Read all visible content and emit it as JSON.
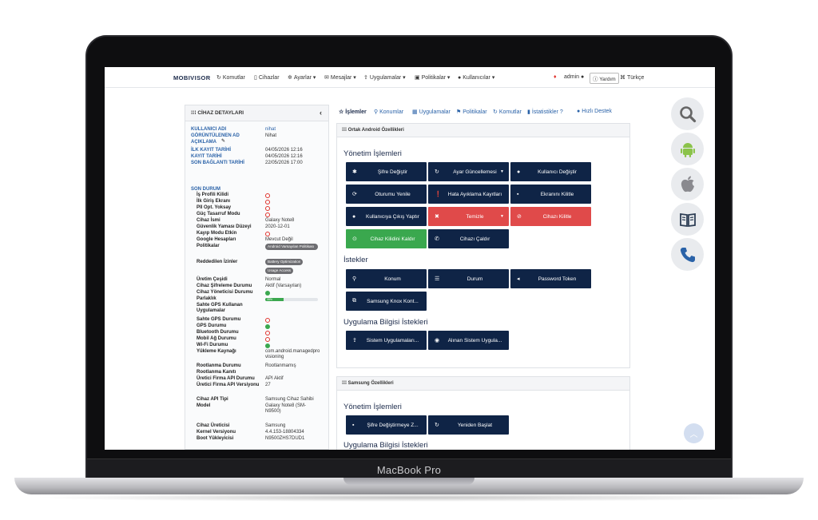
{
  "device_label": "MacBook Pro",
  "navbar": {
    "brand": "MOBIVISOR",
    "items": [
      {
        "icon": "command-icon",
        "label": "Komutlar"
      },
      {
        "icon": "device-icon",
        "label": "Cihazlar"
      },
      {
        "icon": "gear-icon",
        "label": "Ayarlar"
      },
      {
        "icon": "envelope-icon",
        "label": "Mesajlar"
      },
      {
        "icon": "apps-icon",
        "label": "Uygulamalar"
      },
      {
        "icon": "policy-icon",
        "label": "Politikalar"
      },
      {
        "icon": "user-icon",
        "label": "Kullanıcılar"
      }
    ],
    "user": "admin",
    "help": "Yardım",
    "language": "Türkçe"
  },
  "device_panel": {
    "title": "CİHAZ DETAYLARI",
    "top_fields": [
      {
        "key": "KULLANICI ADI",
        "value": "nihat"
      },
      {
        "key": "GÖRÜNTÜLENEN AD",
        "value": "Nihat"
      },
      {
        "key": "AÇIKLAMA",
        "value": ""
      },
      {
        "key": "İLK KAYIT TARİHİ",
        "value": "04/05/2026 12:16"
      },
      {
        "key": "KAYIT TARİHİ",
        "value": "04/05/2026 12:16"
      },
      {
        "key": "SON BAĞLANTI TARİHİ",
        "value": "22/05/2026 17:00"
      }
    ],
    "status_heading": "SON DURUM",
    "status_fields": [
      {
        "key": "İş Profili Kilidi",
        "value": "",
        "status": "red"
      },
      {
        "key": "İlk Giriş Ekranı",
        "value": "",
        "status": "red"
      },
      {
        "key": "PII Opt. Yoksay",
        "value": "",
        "status": "red"
      },
      {
        "key": "Güç Tasarruf Modu",
        "value": "",
        "status": "red"
      },
      {
        "key": "Cihaz İsmi",
        "value": "Galaxy Note8"
      },
      {
        "key": "Güvenlik Yaması Düzeyi",
        "value": "2020-12-01"
      },
      {
        "key": "Kayıp Modu Etkin",
        "value": "",
        "status": "red"
      },
      {
        "key": "Google Hesapları",
        "value": "Mevcut Değil"
      },
      {
        "key": "Politikalar",
        "value": "Android Varsayılan Politikası"
      },
      {
        "key": "Reddedilen İzinler",
        "value": "Battery Optimization"
      },
      {
        "key": "",
        "value": "Usage Access"
      },
      {
        "key": "Üretim Çeşidi",
        "value": "Normal"
      },
      {
        "key": "Cihaz Şifreleme Durumu",
        "value": "Aktif (Varsayılan)"
      },
      {
        "key": "Cihaz Yöneticisi Durumu",
        "value": "",
        "status": "green"
      },
      {
        "key": "Parlaklık",
        "value": "35%",
        "progress": 0.35
      },
      {
        "key": "Sahte GPS Kullanan Uygulamalar",
        "value": ""
      },
      {
        "key": "Sahte GPS Durumu",
        "value": "",
        "status": "red"
      },
      {
        "key": "GPS Durumu",
        "value": "",
        "status": "green"
      },
      {
        "key": "Bluetooth Durumu",
        "value": "",
        "status": "red"
      },
      {
        "key": "Mobil Ağ Durumu",
        "value": "",
        "status": "red"
      },
      {
        "key": "Wi-Fi Durumu",
        "value": "",
        "status": "green"
      },
      {
        "key": "Yükleme Kaynağı",
        "value": "com.android.managedprovisioning"
      },
      {
        "key": "Rootlanma Durumu",
        "value": "Rootlanmamış"
      },
      {
        "key": "Rootlanma Kanıtı",
        "value": ""
      },
      {
        "key": "Üretici Firma API Durumu",
        "value": "API Aktif"
      },
      {
        "key": "Üretici Firma API Versiyonu",
        "value": "27"
      },
      {
        "key": "Cihaz API Tipi",
        "value": "Samsung Cihaz Sahibi"
      },
      {
        "key": "Model",
        "value": "Galaxy Note8 (SM-N9500)"
      },
      {
        "key": "Cihaz Üreticisi",
        "value": "Samsung"
      },
      {
        "key": "Kernel Versiyonu",
        "value": "4.4.153-18804334"
      },
      {
        "key": "Boot Yükleyicisi",
        "value": "N9500ZHS7DUD1"
      }
    ]
  },
  "tabs": [
    "İşlemler",
    "Konumlar",
    "Uygulamalar",
    "Politikalar",
    "Komutlar",
    "İstatistikler",
    "Hızlı Destek"
  ],
  "android_card": {
    "title": "Ortak Android Özellikleri",
    "section_management": "Yönetim İşlemleri",
    "management_buttons": [
      {
        "icon": "asterisk-icon",
        "label": "Şifre Değiştir",
        "style": "dark"
      },
      {
        "icon": "refresh-icon",
        "label": "Ayar Güncellemesi",
        "style": "dark",
        "caret": true
      },
      {
        "icon": "user-icon",
        "label": "Kullanıcı Değiştir",
        "style": "dark"
      },
      {
        "icon": "sync-icon",
        "label": "Oturumu Yenile",
        "style": "dark"
      },
      {
        "icon": "alert-icon",
        "label": "Hata Ayıklama Kayıtları",
        "style": "dark"
      },
      {
        "icon": "lock-icon",
        "label": "Ekranını Kilitle",
        "style": "dark"
      },
      {
        "icon": "logout-user-icon",
        "label": "Kullanıcıya Çıkış Yaptır",
        "style": "dark"
      },
      {
        "icon": "x-icon",
        "label": "Temizle",
        "style": "red",
        "caret": true
      },
      {
        "icon": "ban-icon",
        "label": "Cihazı Kilitle",
        "style": "red"
      },
      {
        "icon": "unlock-icon",
        "label": "Cihaz Kilidini Kaldır",
        "style": "green"
      },
      {
        "icon": "phone-icon",
        "label": "Cihazı Çaldır",
        "style": "dark"
      }
    ],
    "section_requests": "İstekler",
    "request_buttons": [
      {
        "icon": "pin-icon",
        "label": "Konum"
      },
      {
        "icon": "list-icon",
        "label": "Durum"
      },
      {
        "icon": "send-icon",
        "label": "Password Token"
      },
      {
        "icon": "knox-icon",
        "label": "Samsung Knox Kont..."
      }
    ],
    "section_app_info": "Uygulama Bilgisi İstekleri",
    "app_info_buttons": [
      {
        "icon": "apps-upload-icon",
        "label": "Sistem Uygulamaları..."
      },
      {
        "icon": "eye-icon",
        "label": "Alınan Sistem Uygula..."
      }
    ]
  },
  "samsung_card": {
    "title": "Samsung Özellikleri",
    "section_management": "Yönetim İşlemleri",
    "buttons": [
      {
        "icon": "lock-icon",
        "label": "Şifre Değiştirmeye Z..."
      },
      {
        "icon": "refresh-icon",
        "label": "Yeniden Başlat"
      }
    ],
    "section_app_info": "Uygulama Bilgisi İstekleri"
  },
  "side_icons": [
    "search-icon",
    "android-icon",
    "apple-icon",
    "book-icon",
    "phone-icon"
  ],
  "colors": {
    "primary": "#0f2446",
    "danger": "#e04a4a",
    "success": "#3aa84e",
    "link": "#2a62a8"
  }
}
